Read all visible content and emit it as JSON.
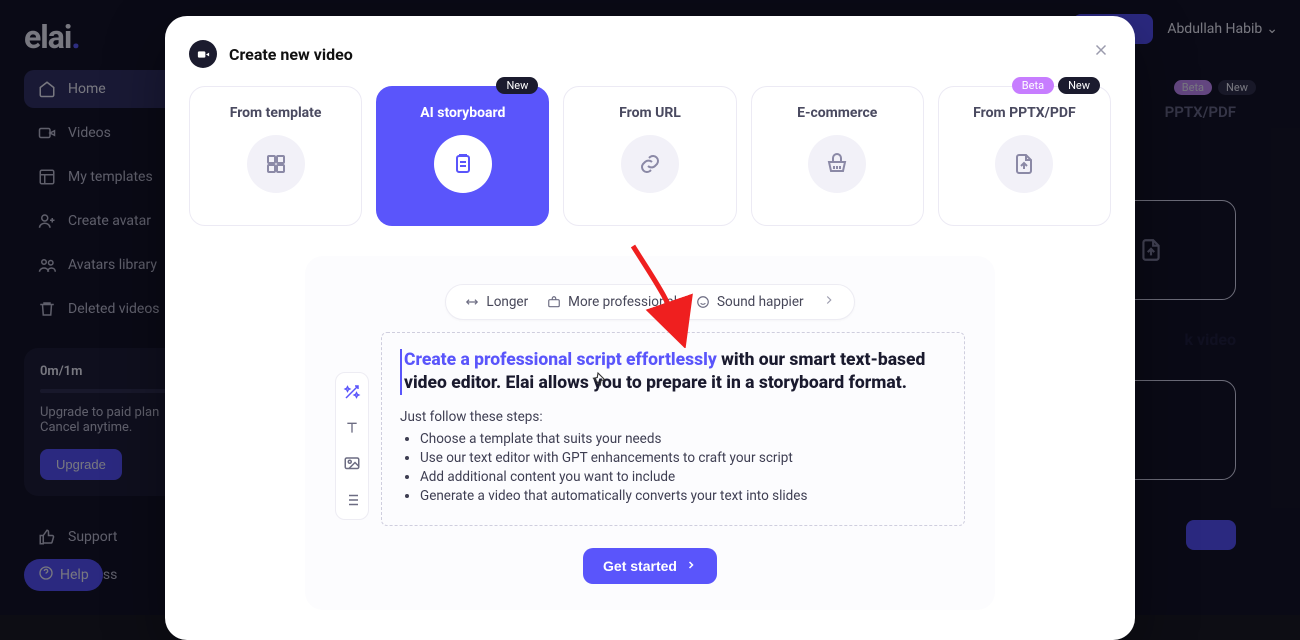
{
  "brand": "elai",
  "user_name": "Abdullah Habib",
  "sidebar": {
    "items": [
      {
        "label": "Home"
      },
      {
        "label": "Videos"
      },
      {
        "label": "My templates"
      },
      {
        "label": "Create avatar"
      },
      {
        "label": "Avatars library"
      },
      {
        "label": "Deleted videos"
      }
    ],
    "footer": [
      {
        "label": "Support"
      },
      {
        "label": "Discuss"
      }
    ]
  },
  "usage": {
    "label": "0m/1m",
    "text1": "Upgrade to paid plan",
    "text2": "Cancel anytime.",
    "button": "Upgrade"
  },
  "help_label": "Help",
  "bg": {
    "badge_beta": "Beta",
    "badge_new": "New",
    "option_label": "PPTX/PDF",
    "section_heading": "k video"
  },
  "modal": {
    "title": "Create new video",
    "options": [
      {
        "label": "From template"
      },
      {
        "label": "AI storyboard",
        "badge_new": "New"
      },
      {
        "label": "From URL"
      },
      {
        "label": "E-commerce"
      },
      {
        "label": "From PPTX/PDF",
        "badge_beta": "Beta",
        "badge_new": "New"
      }
    ],
    "suggestions": {
      "longer": "Longer",
      "professional": "More professional",
      "happier": "Sound happier"
    },
    "editor": {
      "headline_highlight": "Create a professional script effortlessly",
      "headline_rest": " with our smart text-based video editor. Elai allows you to prepare it in a storyboard format.",
      "steps_intro": "Just follow these steps:",
      "steps": [
        "Choose a template that suits your needs",
        "Use our text editor with GPT enhancements to craft your script",
        "Add additional content you want to include",
        "Generate a video that automatically converts your text into slides"
      ]
    },
    "start_button": "Get started"
  }
}
